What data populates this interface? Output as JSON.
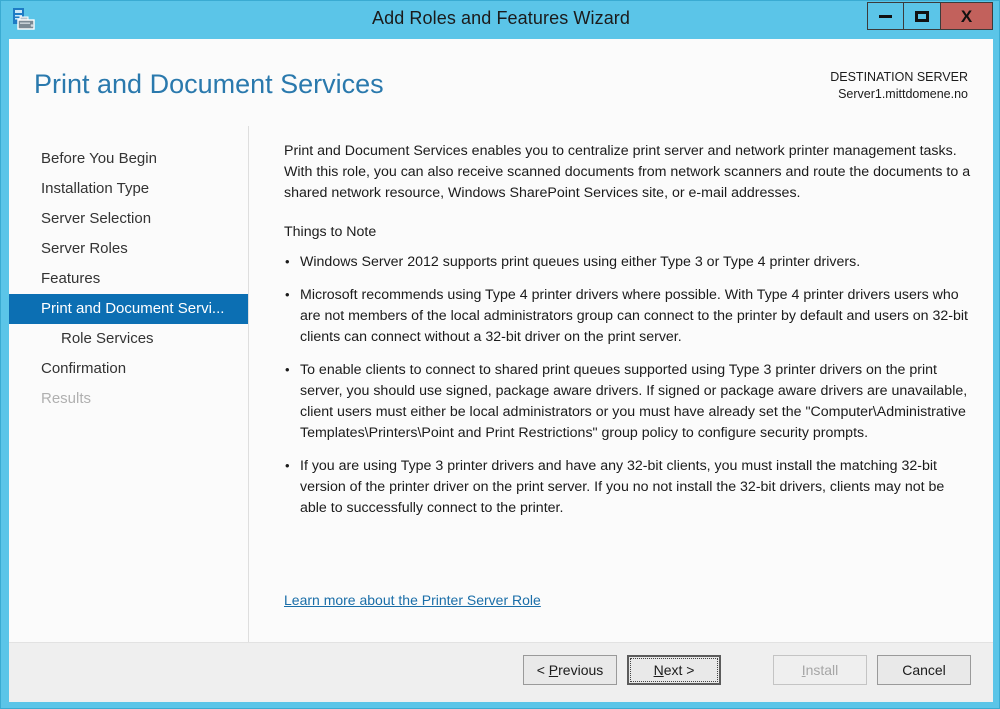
{
  "window": {
    "title": "Add Roles and Features Wizard",
    "icon": "server-manager-icon",
    "controls": {
      "minimize": "minimize-icon",
      "maximize": "maximize-icon",
      "close": "X"
    },
    "frame_color": "#5bc5e8",
    "close_color": "#c2615c"
  },
  "header": {
    "page_title": "Print and Document Services",
    "title_color": "#2a79ad",
    "destination_label": "DESTINATION SERVER",
    "destination_value": "Server1.mittdomene.no"
  },
  "sidebar": {
    "selected_index": 5,
    "highlight_color": "#0c6fb3",
    "items": [
      {
        "label": "Before You Begin",
        "state": "normal",
        "indent": false
      },
      {
        "label": "Installation Type",
        "state": "normal",
        "indent": false
      },
      {
        "label": "Server Selection",
        "state": "normal",
        "indent": false
      },
      {
        "label": "Server Roles",
        "state": "normal",
        "indent": false
      },
      {
        "label": "Features",
        "state": "normal",
        "indent": false
      },
      {
        "label": "Print and Document Servi...",
        "state": "selected",
        "indent": false
      },
      {
        "label": "Role Services",
        "state": "normal",
        "indent": true
      },
      {
        "label": "Confirmation",
        "state": "normal",
        "indent": false
      },
      {
        "label": "Results",
        "state": "disabled",
        "indent": false
      }
    ]
  },
  "content": {
    "intro": "Print and Document Services enables you to centralize print server and network printer management tasks. With this role, you can also receive scanned documents from network scanners and route the documents to a shared network resource, Windows SharePoint Services site, or e-mail addresses.",
    "notes_heading": "Things to Note",
    "notes": [
      "Windows Server 2012 supports print queues using either Type 3 or Type 4 printer drivers.",
      "Microsoft recommends using Type 4 printer drivers where possible. With Type 4 printer drivers users who are not members of the local administrators group can connect to the printer by default and users on 32-bit clients can connect without a 32-bit driver on the print server.",
      "To enable clients to connect to shared print queues supported using Type 3 printer drivers on the print server, you should use signed, package aware drivers. If signed or package aware drivers are unavailable, client users must either be local administrators or you must have already set the \"Computer\\Administrative Templates\\Printers\\Point and Print Restrictions\" group policy to configure security prompts.",
      "If you are using Type 3 printer drivers and have any 32-bit clients, you must install the matching 32-bit version of the printer driver on the print server. If you no not install the 32-bit drivers, clients may not be able to successfully connect to the printer."
    ],
    "learn_more_link": "Learn more about the Printer Server Role",
    "link_color": "#1a6ea8"
  },
  "footer": {
    "buttons": [
      {
        "label": "< Previous",
        "accel": "P",
        "state": "normal"
      },
      {
        "label": "Next >",
        "accel": "N",
        "state": "default"
      },
      {
        "label": "Install",
        "accel": "I",
        "state": "disabled"
      },
      {
        "label": "Cancel",
        "accel": "",
        "state": "normal"
      }
    ]
  }
}
